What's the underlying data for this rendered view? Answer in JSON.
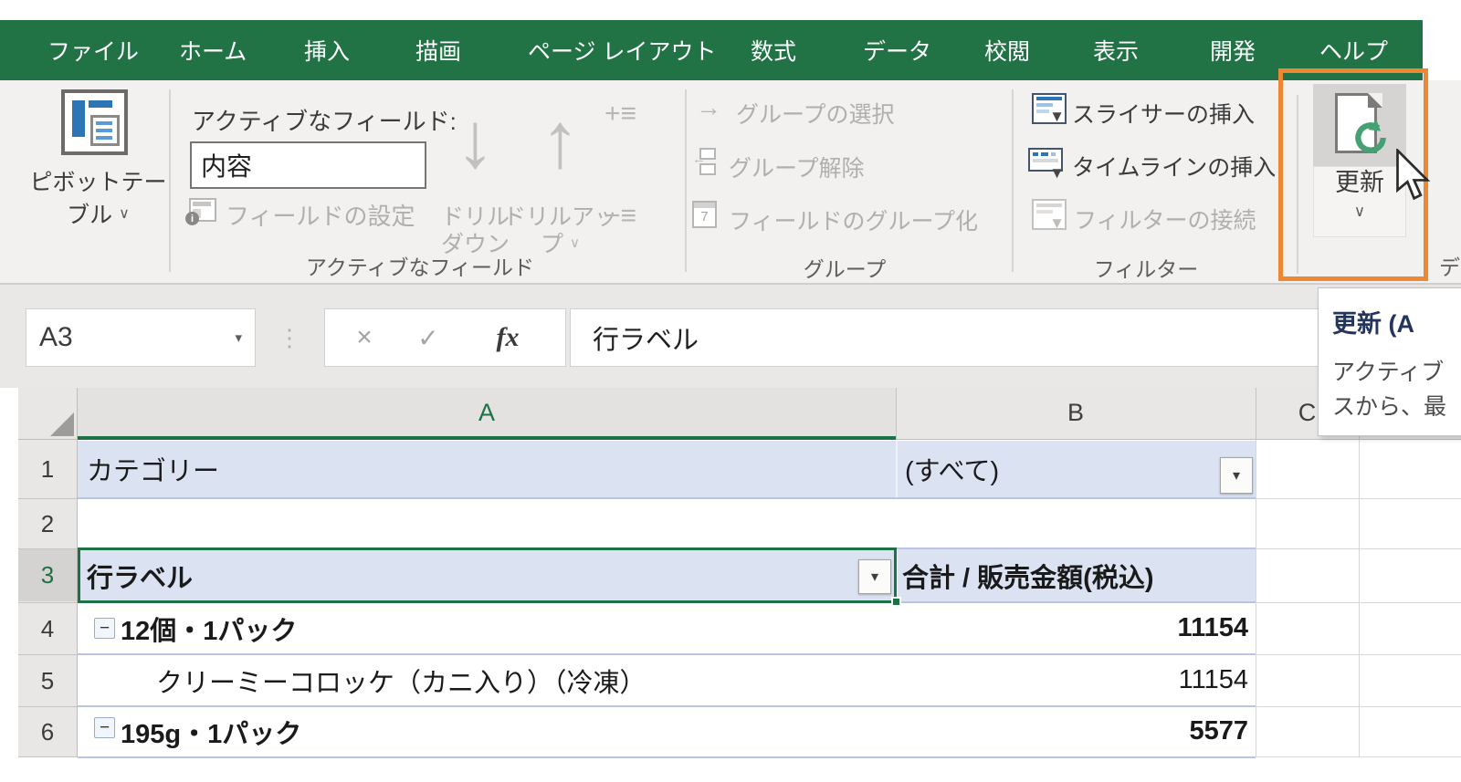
{
  "colors": {
    "excel_green": "#217346",
    "highlight_orange": "#ED8733",
    "pivot_row_bg": "#DBE3F3",
    "selection_green": "#1E7145",
    "refresh_green": "#46A072",
    "tooltip_title": "#24355C"
  },
  "menu": {
    "tabs": [
      "ファイル",
      "ホーム",
      "挿入",
      "描画",
      "ページ レイアウト",
      "数式",
      "データ",
      "校閲",
      "表示",
      "開発",
      "ヘルプ"
    ]
  },
  "ribbon": {
    "pivottable": {
      "label_line1": "ピボットテー",
      "label_line2": "ブル"
    },
    "active_field": {
      "group_label": "アクティブなフィールド",
      "field_caption": "アクティブなフィールド:",
      "field_value": "内容",
      "settings_label": "フィールドの設定",
      "drilldown_line1": "ドリル",
      "drilldown_line2": "ダウン",
      "drillup_line1": "ドリルアッ",
      "drillup_line2": "プ"
    },
    "group_group": {
      "group_label": "グループ",
      "select_label": "グループの選択",
      "ungroup_label": "グループ解除",
      "group_field_label": "フィールドのグループ化",
      "calendar_digit": "7"
    },
    "filter_group": {
      "group_label": "フィルター",
      "slicer_label": "スライサーの挿入",
      "timeline_label": "タイムラインの挿入",
      "connection_label": "フィルターの接続"
    },
    "data_group": {
      "refresh_label": "更新",
      "group_label_partial": "デ"
    }
  },
  "tooltip": {
    "title": "更新 (A",
    "body_line1": "アクティブ",
    "body_line2": "スから、最"
  },
  "formula_bar": {
    "name_box_value": "A3",
    "formula_value": "行ラベル"
  },
  "grid": {
    "column_headers": {
      "a": "A",
      "b": "B",
      "c": "C"
    },
    "rows": {
      "r1": {
        "num": "1",
        "a": "カテゴリー",
        "b": "(すべて)"
      },
      "r2": {
        "num": "2",
        "a": "",
        "b": ""
      },
      "r3": {
        "num": "3",
        "a": "行ラベル",
        "b": "合計 / 販売金額(税込)"
      },
      "r4": {
        "num": "4",
        "a": "12個・1パック",
        "b": "11154"
      },
      "r5": {
        "num": "5",
        "a": "クリーミーコロッケ（カニ入り）（冷凍）",
        "b": "11154"
      },
      "r6": {
        "num": "6",
        "a": "195g・1パック",
        "b": "5577"
      }
    }
  },
  "glyphs": {
    "dropdown": "▾",
    "chevron_down": "∨",
    "cancel": "×",
    "check": "✓",
    "fx": "fx",
    "arrow_down": "↓",
    "arrow_up": "↑",
    "arrow_right": "→",
    "plus_lines": "+≡",
    "minus_lines": "−≡",
    "vertical_dots": "⋮",
    "funnel": "▼",
    "collapse": "−",
    "info": "i"
  }
}
